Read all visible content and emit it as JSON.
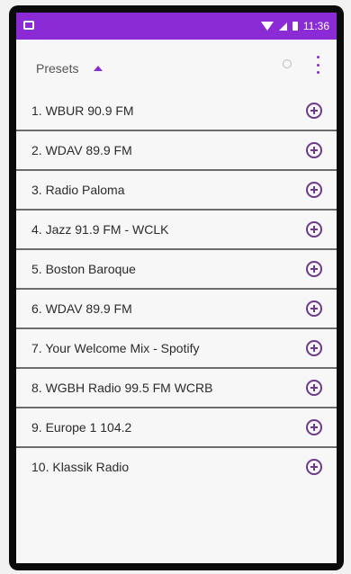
{
  "status_bar": {
    "time": "11:36"
  },
  "header": {
    "title": "Presets"
  },
  "presets": [
    {
      "label": "1.  WBUR 90.9 FM"
    },
    {
      "label": "2.  WDAV 89.9 FM"
    },
    {
      "label": "3.  Radio Paloma"
    },
    {
      "label": "4.  Jazz 91.9 FM - WCLK"
    },
    {
      "label": "5.  Boston Baroque"
    },
    {
      "label": "6.  WDAV 89.9 FM"
    },
    {
      "label": "7.  Your Welcome Mix - Spotify"
    },
    {
      "label": "8.  WGBH Radio 99.5 FM WCRB"
    },
    {
      "label": "9.  Europe 1 104.2"
    },
    {
      "label": "10.  Klassik Radio"
    }
  ],
  "colors": {
    "accent": "#8b2bd6",
    "icon": "#6d3a8a"
  },
  "icons": {
    "add": "plus-circle-icon",
    "more": "more-vert-icon",
    "refresh": "refresh-icon",
    "sort": "caret-up-icon"
  }
}
